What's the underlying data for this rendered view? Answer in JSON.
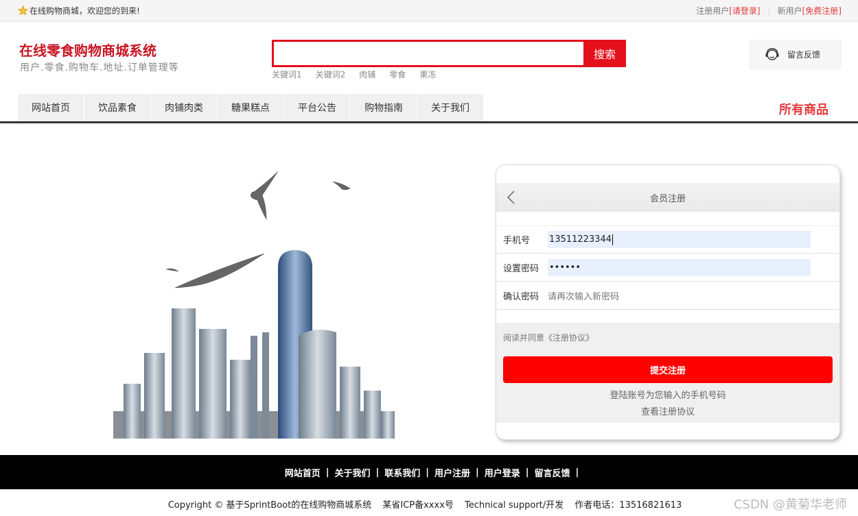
{
  "topbar": {
    "welcome": "在线购物商城，欢迎您的到来!",
    "registered_user": "注册用户",
    "login_link": "[请登录]",
    "new_user": "新用户",
    "register_link": "[免费注册]"
  },
  "header": {
    "title": "在线零食购物商城系统",
    "subtitle": "用户.零食.购物车.地址.订单管理等",
    "search_value": "",
    "search_button": "搜索",
    "hotwords": [
      "关键词1",
      "关键词2",
      "肉铺",
      "零食",
      "果冻"
    ],
    "feedback": "留言反馈"
  },
  "nav": {
    "items": [
      "网站首页",
      "饮品素食",
      "肉铺肉类",
      "糖果糕点",
      "平台公告",
      "购物指南",
      "关于我们"
    ],
    "all_goods": "所有商品"
  },
  "register": {
    "title": "会员注册",
    "phone_label": "手机号",
    "phone_value": "13511223344",
    "password_label": "设置密码",
    "password_value": "••••••",
    "confirm_label": "确认密码",
    "confirm_placeholder": "请再次输入新密码",
    "agree_text": "阅读并同意《注册协议》",
    "submit": "提交注册",
    "hint1": "登陆账号为您输入的手机号码",
    "hint2": "查看注册协议"
  },
  "footer": {
    "links": [
      "网站首页",
      "关于我们",
      "联系我们",
      "用户注册",
      "用户登录",
      "留言反馈"
    ],
    "copyright": "Copyright © 基于SprintBoot的在线购物商城系统",
    "icp": "某省ICP备xxxx号",
    "support": "Technical support/开发",
    "phone": "作者电话：13516821613",
    "watermark": "CSDN @黄菊华老师"
  },
  "colors": {
    "brand_red": "#e4101b",
    "title_red": "#c81623",
    "submit_red": "#ff0000",
    "footer_bg": "#000000"
  }
}
